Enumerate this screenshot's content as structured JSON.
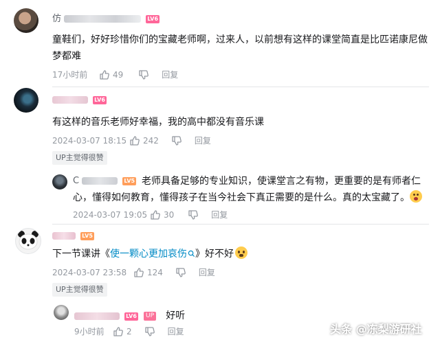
{
  "comments": [
    {
      "username_visible": "仿",
      "level": "LV6",
      "text": "童鞋们，好好珍惜你们的宝藏老师啊，过来人，以前想有这样的课堂简直是比匹诺康尼做梦都难",
      "time": "17小时前",
      "likes": "49",
      "reply_label": "回复"
    },
    {
      "level": "LV6",
      "text": "有这样的音乐老师好幸福，我的高中都没有音乐课",
      "time": "2024-03-07 18:15",
      "likes": "242",
      "reply_label": "回复",
      "badge": "UP主觉得很赞",
      "reply": {
        "username_visible": "C",
        "level": "LV5",
        "text": "老师具备足够的专业知识，使课堂言之有物，更重要的是有师者仁心，懂得如何教育，懂得孩子在当今社会下真正需要的是什么。真的太宝藏了。",
        "time": "2024-03-07 19:05",
        "likes": "30",
        "reply_label": "回复"
      }
    },
    {
      "level": "LV5",
      "text_before": "下一节课讲《",
      "link": "使一颗心更加哀伤",
      "text_after": "》好不好",
      "time": "2024-03-07 23:58",
      "likes": "124",
      "reply_label": "回复",
      "badge": "UP主觉得很赞",
      "reply": {
        "level": "LV6",
        "up_tag": "UP",
        "text": "好听",
        "time": "9小时前",
        "likes": "2",
        "reply_label": "回复"
      }
    }
  ],
  "watermark": "头条 @冻梨游研社",
  "colors": {
    "text": "#18191c",
    "meta": "#9499a0",
    "link": "#008ac5",
    "lv6": "#ff6699",
    "lv5": "#ff9e5b",
    "up": "#fb7299"
  }
}
